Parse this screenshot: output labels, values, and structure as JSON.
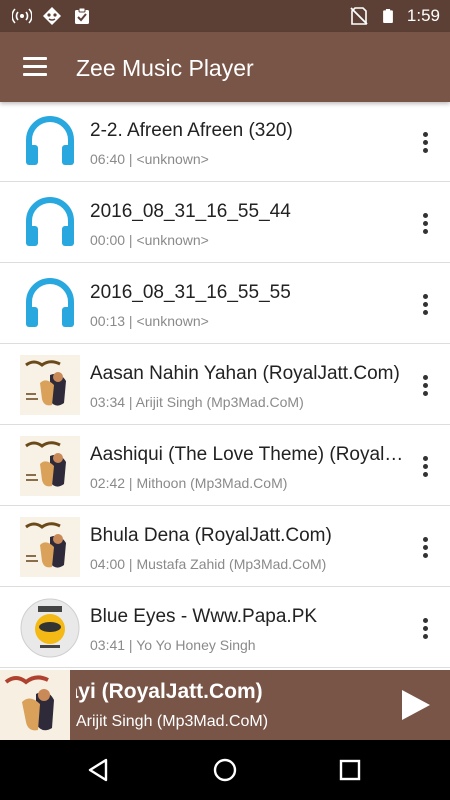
{
  "status_bar": {
    "time": "1:59",
    "icons": [
      "wifi-tethering-icon",
      "cat-face-icon",
      "clipboard-check-icon",
      "no-sim-icon",
      "battery-icon"
    ]
  },
  "app_bar": {
    "title": "Zee Music Player",
    "menu_icon": "hamburger-menu-icon"
  },
  "songs": [
    {
      "title": "2-2. Afreen Afreen (320)",
      "meta": "06:40 | <unknown>",
      "art": "headphones-icon"
    },
    {
      "title": "2016_08_31_16_55_44",
      "meta": "00:00 | <unknown>",
      "art": "headphones-icon"
    },
    {
      "title": "2016_08_31_16_55_55",
      "meta": "00:13 | <unknown>",
      "art": "headphones-icon"
    },
    {
      "title": "Aasan Nahin Yahan (RoyalJatt.Com)",
      "meta": "03:34 | Arijit Singh (Mp3Mad.CoM)",
      "art": "album-art"
    },
    {
      "title": "Aashiqui (The Love Theme) (RoyalJatt.Com)",
      "meta": "02:42 | Mithoon (Mp3Mad.CoM)",
      "art": "album-art"
    },
    {
      "title": "Bhula Dena (RoyalJatt.Com)",
      "meta": "04:00 | Mustafa Zahid (Mp3Mad.CoM)",
      "art": "album-art"
    },
    {
      "title": "Blue Eyes - Www.Papa.PK",
      "meta": "03:41 | Yo Yo Honey Singh",
      "art": "papa-pk-logo"
    }
  ],
  "now_playing": {
    "title": "Milne Hai Mujhse Aayi (RoyalJatt.Com)",
    "artist": "Arijit Singh (Mp3Mad.CoM)",
    "play_icon": "play-icon"
  },
  "colors": {
    "app_bar": "#795548",
    "status_bar": "#5d4035",
    "headphones": "#29a8e0",
    "divider": "#dddddd"
  },
  "nav_bar": {
    "icons": [
      "back-icon",
      "home-icon",
      "recents-icon"
    ]
  }
}
